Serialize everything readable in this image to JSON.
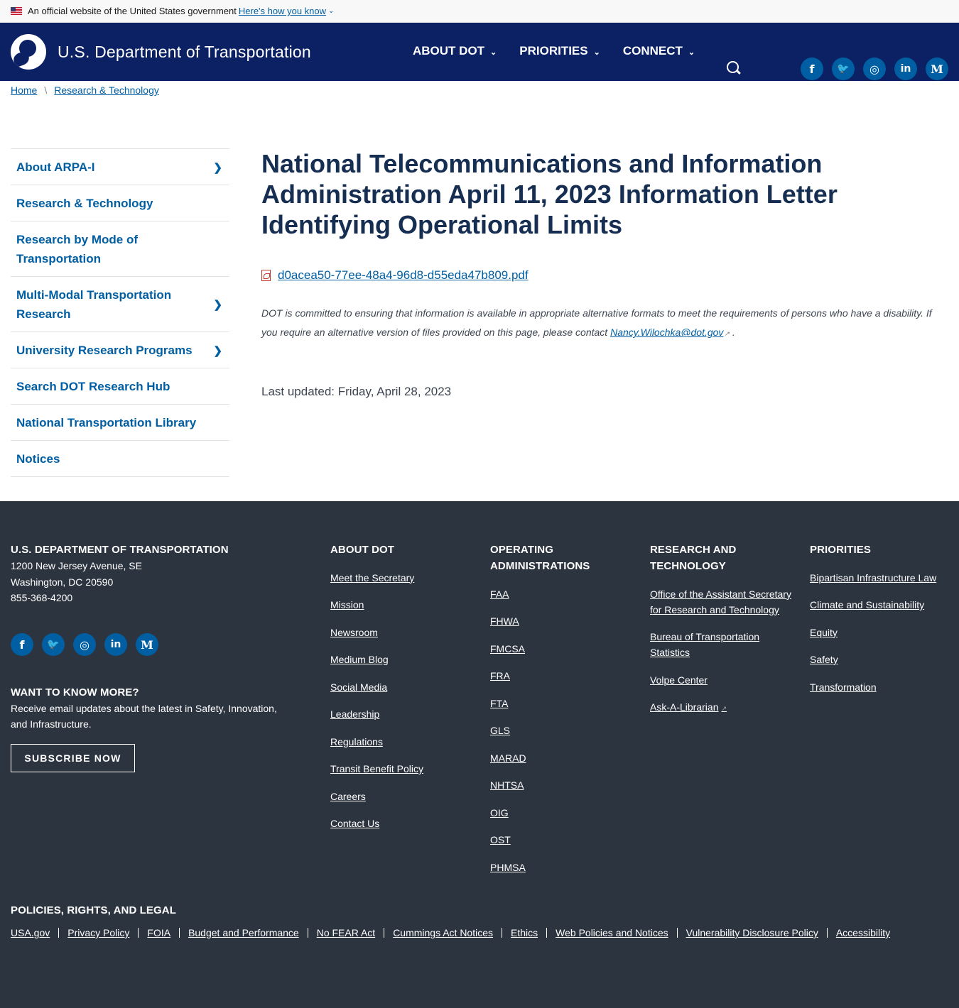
{
  "gov_banner": {
    "text": "An official website of the United States government",
    "link": "Here's how you know"
  },
  "header": {
    "logo_text": "U.S. Department of Transportation",
    "nav": [
      "ABOUT DOT",
      "PRIORITIES",
      "CONNECT"
    ],
    "social": [
      {
        "icon": "facebook-icon",
        "glyph": "f"
      },
      {
        "icon": "twitter-icon",
        "glyph": "🐦"
      },
      {
        "icon": "instagram-icon",
        "glyph": "◎"
      },
      {
        "icon": "linkedin-icon",
        "glyph": "in"
      },
      {
        "icon": "medium-icon",
        "glyph": "M"
      }
    ]
  },
  "breadcrumb": [
    "Home",
    "Research & Technology"
  ],
  "sidenav": [
    {
      "label": "About ARPA-I",
      "has_children": true
    },
    {
      "label": "Research & Technology",
      "has_children": false
    },
    {
      "label": "Research by Mode of Transportation",
      "has_children": false
    },
    {
      "label": "Multi-Modal Transportation Research",
      "has_children": true
    },
    {
      "label": "University Research Programs",
      "has_children": true
    },
    {
      "label": "Search DOT Research Hub",
      "has_children": false
    },
    {
      "label": "National Transportation Library",
      "has_children": false
    },
    {
      "label": "Notices",
      "has_children": false
    }
  ],
  "main": {
    "title": "National Telecommunications and Information Administration April 11, 2023 Information Letter Identifying Operational Limits",
    "file": "d0acea50-77ee-48a4-96d8-d55eda47b809.pdf",
    "note_text": "DOT is committed to ensuring that information is available in appropriate alternative formats to meet the requirements of persons who have a disability. If you require an alternative version of files provided on this page, please contact",
    "note_email": "Nancy.Wilochka@dot.gov",
    "note_end": " .",
    "last_updated": "Last updated: Friday, April 28, 2023"
  },
  "footer": {
    "dept": {
      "heading": "U.S. DEPARTMENT OF TRANSPORTATION",
      "address": [
        "1200 New Jersey Avenue, SE",
        "Washington, DC 20590",
        "855-368-4200"
      ]
    },
    "want": {
      "heading": "WANT TO KNOW MORE?",
      "text": "Receive email updates about the latest in Safety, Innovation, and Infrastructure.",
      "button": "SUBSCRIBE NOW"
    },
    "about": {
      "heading": "ABOUT DOT",
      "links": [
        "Meet the Secretary",
        "Mission",
        "Newsroom",
        "Medium Blog",
        "Social Media",
        "Leadership",
        "Regulations",
        "Transit Benefit Policy",
        "Careers",
        "Contact Us"
      ]
    },
    "operating": {
      "heading": "OPERATING ADMINISTRATIONS",
      "links": [
        "FAA",
        "FHWA",
        "FMCSA",
        "FRA",
        "FTA",
        "GLS",
        "MARAD",
        "NHTSA",
        "OIG",
        "OST",
        "PHMSA"
      ]
    },
    "research": {
      "heading": "RESEARCH AND TECHNOLOGY",
      "links": [
        "Office of the Assistant Secretary for Research and Technology",
        "Bureau of Transportation Statistics",
        "Volpe Center",
        "Ask-A-Librarian"
      ]
    },
    "priorities": {
      "heading": "PRIORITIES",
      "links": [
        "Bipartisan Infrastructure Law",
        "Climate and Sustainability",
        "Equity",
        "Safety",
        "Transformation"
      ]
    },
    "policies": {
      "heading": "POLICIES, RIGHTS, AND LEGAL",
      "links": [
        "USA.gov",
        "Privacy Policy",
        "FOIA",
        "Budget and Performance",
        "No FEAR Act",
        "Cummings Act Notices",
        "Ethics",
        "Web Policies and Notices",
        "Vulnerability Disclosure Policy",
        "Accessibility"
      ]
    }
  }
}
